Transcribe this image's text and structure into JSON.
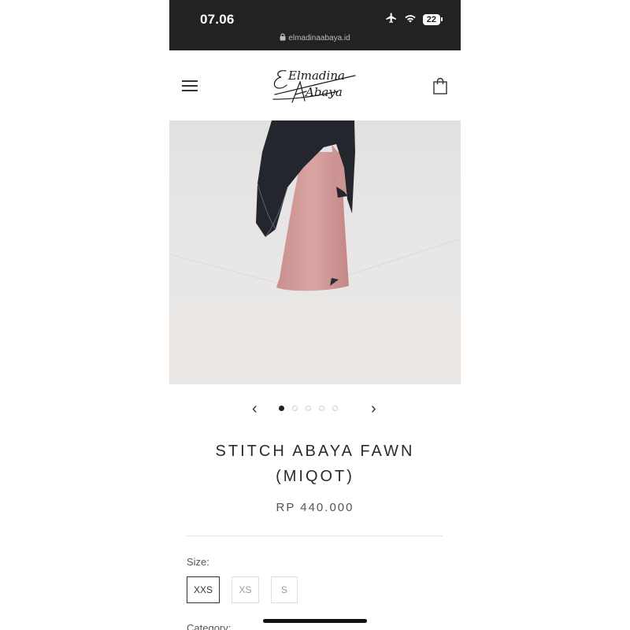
{
  "status_bar": {
    "time": "07.06",
    "battery": "22"
  },
  "browser": {
    "url": "elmadinaabaya.id"
  },
  "header": {
    "brand": "Elmadina Abaya",
    "logo_line1": "Elmadina",
    "logo_line2": "Abaya"
  },
  "carousel": {
    "total_images": 5,
    "active_index": 0
  },
  "product": {
    "title_line1": "STITCH ABAYA FAWN",
    "title_line2": "(MIQOT)",
    "price": "RP 440.000"
  },
  "options": {
    "size_label": "Size:",
    "sizes": [
      "XXS",
      "XS",
      "S"
    ],
    "selected_size": "XXS",
    "category_label": "Category:"
  }
}
